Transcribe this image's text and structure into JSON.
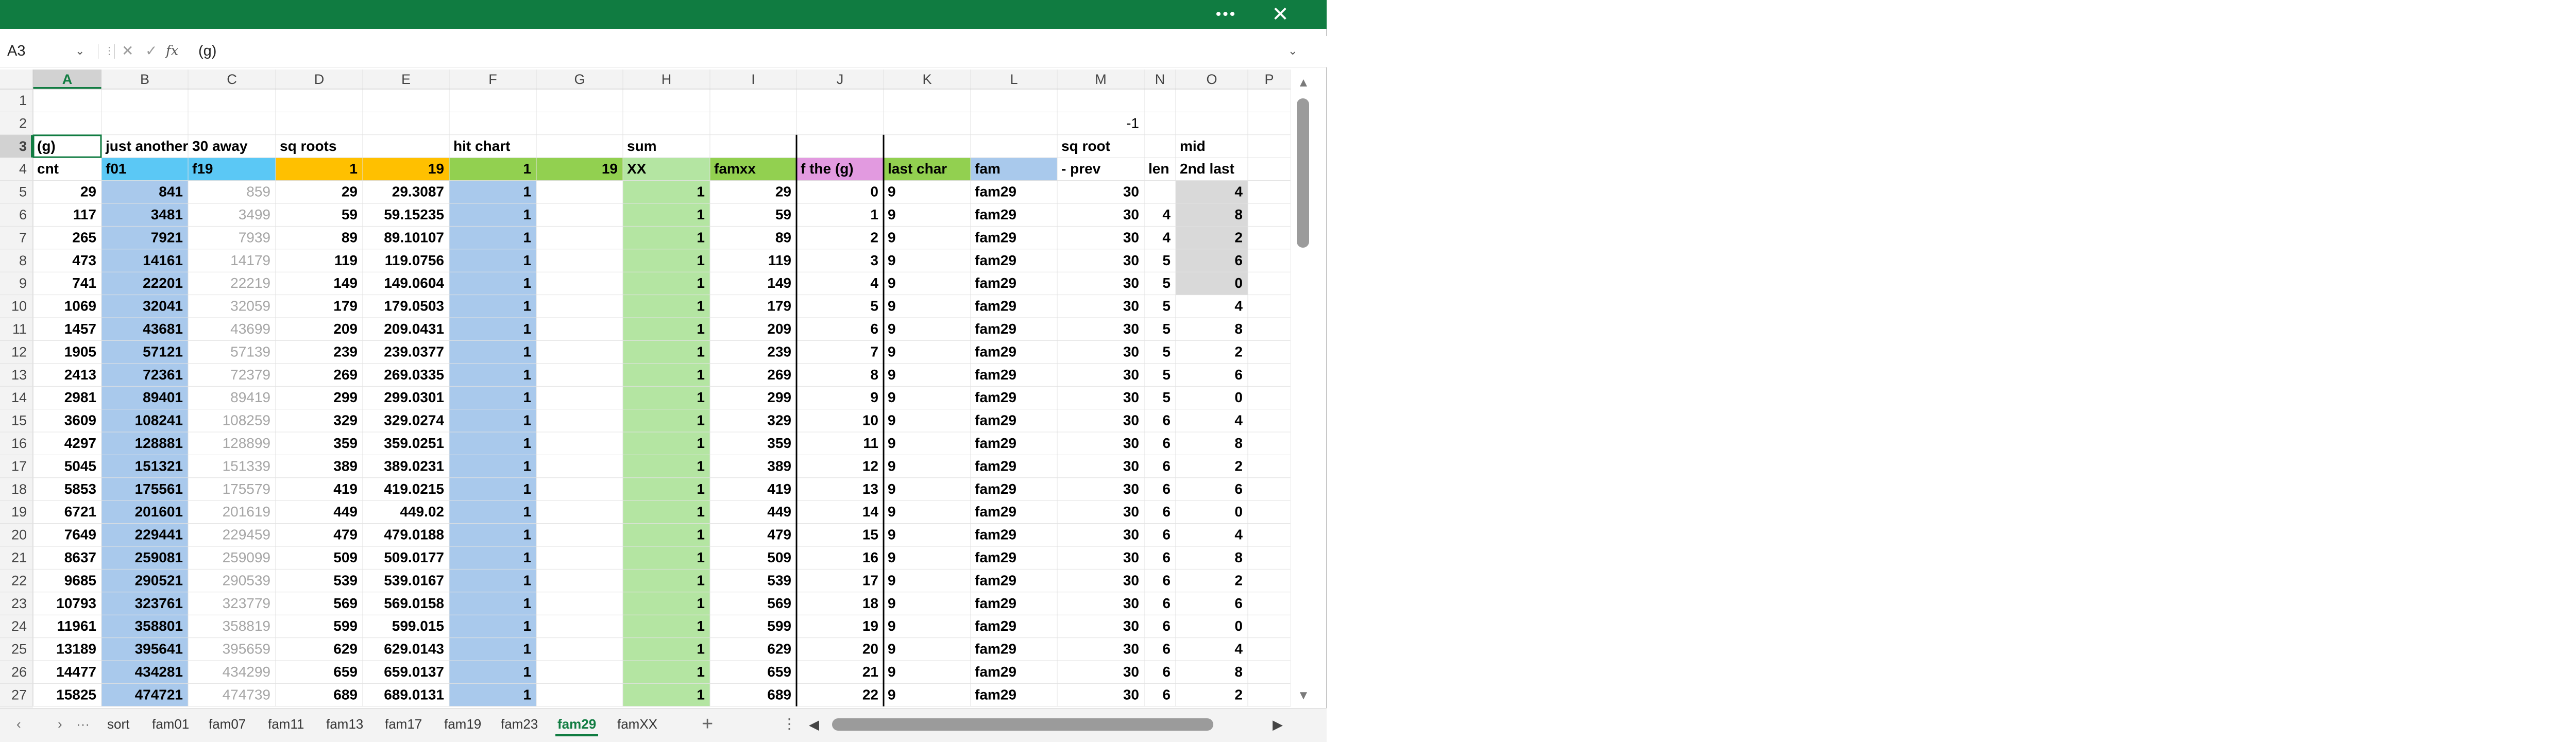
{
  "window": {
    "more_icon": "ellipsis-icon",
    "more_label": "•••",
    "close_icon": "close-icon",
    "close_label": "✕"
  },
  "formula_bar": {
    "name_box": "A3",
    "formula_value": "(g)"
  },
  "columns": [
    "A",
    "B",
    "C",
    "D",
    "E",
    "F",
    "G",
    "H",
    "I",
    "J",
    "K",
    "L",
    "M",
    "N",
    "O",
    "P"
  ],
  "selected_column": "A",
  "row_numbers": [
    1,
    2,
    3,
    4,
    5,
    6,
    7,
    8,
    9,
    10,
    11,
    12,
    13,
    14,
    15,
    16,
    17,
    18,
    19,
    20,
    21,
    22,
    23,
    24,
    25,
    26,
    27
  ],
  "header_rows": {
    "row2": {
      "M": "-1"
    },
    "row3": {
      "A": "(g)",
      "B": "just another 30 away",
      "D": "sq roots",
      "F": "hit chart",
      "H": "sum",
      "M": "sq root",
      "O": "mid"
    },
    "row4": {
      "A": "cnt",
      "B": "f01",
      "C": "f19",
      "D": "1",
      "E": "19",
      "F": "1",
      "G": "19",
      "H": "XX",
      "I": "famxx",
      "J": "f the (g)",
      "K": "last char",
      "L": "fam",
      "M": "- prev",
      "N": "len",
      "O": "2nd last"
    }
  },
  "fill_colors": {
    "cyan": "#5bc8f5",
    "gold": "#ffc000",
    "green": "#92d050",
    "light_green": "#b4e5a2",
    "light_blue": "#a9c9ec",
    "pink": "#e29ae0",
    "grey": "#d9d9d9",
    "gray_text": "#a6a6a6",
    "accent": "#107c41"
  },
  "data_rows": [
    {
      "A": "29",
      "B": "841",
      "C": "859",
      "D": "29",
      "E": "29.3087",
      "F": "1",
      "H": "1",
      "I": "29",
      "J": "0",
      "K": "9",
      "L": "fam29",
      "M": "30",
      "N": "",
      "O": "4"
    },
    {
      "A": "117",
      "B": "3481",
      "C": "3499",
      "D": "59",
      "E": "59.15235",
      "F": "1",
      "H": "1",
      "I": "59",
      "J": "1",
      "K": "9",
      "L": "fam29",
      "M": "30",
      "N": "4",
      "O": "8"
    },
    {
      "A": "265",
      "B": "7921",
      "C": "7939",
      "D": "89",
      "E": "89.10107",
      "F": "1",
      "H": "1",
      "I": "89",
      "J": "2",
      "K": "9",
      "L": "fam29",
      "M": "30",
      "N": "4",
      "O": "2"
    },
    {
      "A": "473",
      "B": "14161",
      "C": "14179",
      "D": "119",
      "E": "119.0756",
      "F": "1",
      "H": "1",
      "I": "119",
      "J": "3",
      "K": "9",
      "L": "fam29",
      "M": "30",
      "N": "5",
      "O": "6"
    },
    {
      "A": "741",
      "B": "22201",
      "C": "22219",
      "D": "149",
      "E": "149.0604",
      "F": "1",
      "H": "1",
      "I": "149",
      "J": "4",
      "K": "9",
      "L": "fam29",
      "M": "30",
      "N": "5",
      "O": "0"
    },
    {
      "A": "1069",
      "B": "32041",
      "C": "32059",
      "D": "179",
      "E": "179.0503",
      "F": "1",
      "H": "1",
      "I": "179",
      "J": "5",
      "K": "9",
      "L": "fam29",
      "M": "30",
      "N": "5",
      "O": "4"
    },
    {
      "A": "1457",
      "B": "43681",
      "C": "43699",
      "D": "209",
      "E": "209.0431",
      "F": "1",
      "H": "1",
      "I": "209",
      "J": "6",
      "K": "9",
      "L": "fam29",
      "M": "30",
      "N": "5",
      "O": "8"
    },
    {
      "A": "1905",
      "B": "57121",
      "C": "57139",
      "D": "239",
      "E": "239.0377",
      "F": "1",
      "H": "1",
      "I": "239",
      "J": "7",
      "K": "9",
      "L": "fam29",
      "M": "30",
      "N": "5",
      "O": "2"
    },
    {
      "A": "2413",
      "B": "72361",
      "C": "72379",
      "D": "269",
      "E": "269.0335",
      "F": "1",
      "H": "1",
      "I": "269",
      "J": "8",
      "K": "9",
      "L": "fam29",
      "M": "30",
      "N": "5",
      "O": "6"
    },
    {
      "A": "2981",
      "B": "89401",
      "C": "89419",
      "D": "299",
      "E": "299.0301",
      "F": "1",
      "H": "1",
      "I": "299",
      "J": "9",
      "K": "9",
      "L": "fam29",
      "M": "30",
      "N": "5",
      "O": "0"
    },
    {
      "A": "3609",
      "B": "108241",
      "C": "108259",
      "D": "329",
      "E": "329.0274",
      "F": "1",
      "H": "1",
      "I": "329",
      "J": "10",
      "K": "9",
      "L": "fam29",
      "M": "30",
      "N": "6",
      "O": "4"
    },
    {
      "A": "4297",
      "B": "128881",
      "C": "128899",
      "D": "359",
      "E": "359.0251",
      "F": "1",
      "H": "1",
      "I": "359",
      "J": "11",
      "K": "9",
      "L": "fam29",
      "M": "30",
      "N": "6",
      "O": "8"
    },
    {
      "A": "5045",
      "B": "151321",
      "C": "151339",
      "D": "389",
      "E": "389.0231",
      "F": "1",
      "H": "1",
      "I": "389",
      "J": "12",
      "K": "9",
      "L": "fam29",
      "M": "30",
      "N": "6",
      "O": "2"
    },
    {
      "A": "5853",
      "B": "175561",
      "C": "175579",
      "D": "419",
      "E": "419.0215",
      "F": "1",
      "H": "1",
      "I": "419",
      "J": "13",
      "K": "9",
      "L": "fam29",
      "M": "30",
      "N": "6",
      "O": "6"
    },
    {
      "A": "6721",
      "B": "201601",
      "C": "201619",
      "D": "449",
      "E": "449.02",
      "F": "1",
      "H": "1",
      "I": "449",
      "J": "14",
      "K": "9",
      "L": "fam29",
      "M": "30",
      "N": "6",
      "O": "0"
    },
    {
      "A": "7649",
      "B": "229441",
      "C": "229459",
      "D": "479",
      "E": "479.0188",
      "F": "1",
      "H": "1",
      "I": "479",
      "J": "15",
      "K": "9",
      "L": "fam29",
      "M": "30",
      "N": "6",
      "O": "4"
    },
    {
      "A": "8637",
      "B": "259081",
      "C": "259099",
      "D": "509",
      "E": "509.0177",
      "F": "1",
      "H": "1",
      "I": "509",
      "J": "16",
      "K": "9",
      "L": "fam29",
      "M": "30",
      "N": "6",
      "O": "8"
    },
    {
      "A": "9685",
      "B": "290521",
      "C": "290539",
      "D": "539",
      "E": "539.0167",
      "F": "1",
      "H": "1",
      "I": "539",
      "J": "17",
      "K": "9",
      "L": "fam29",
      "M": "30",
      "N": "6",
      "O": "2"
    },
    {
      "A": "10793",
      "B": "323761",
      "C": "323779",
      "D": "569",
      "E": "569.0158",
      "F": "1",
      "H": "1",
      "I": "569",
      "J": "18",
      "K": "9",
      "L": "fam29",
      "M": "30",
      "N": "6",
      "O": "6"
    },
    {
      "A": "11961",
      "B": "358801",
      "C": "358819",
      "D": "599",
      "E": "599.015",
      "F": "1",
      "H": "1",
      "I": "599",
      "J": "19",
      "K": "9",
      "L": "fam29",
      "M": "30",
      "N": "6",
      "O": "0"
    },
    {
      "A": "13189",
      "B": "395641",
      "C": "395659",
      "D": "629",
      "E": "629.0143",
      "F": "1",
      "H": "1",
      "I": "629",
      "J": "20",
      "K": "9",
      "L": "fam29",
      "M": "30",
      "N": "6",
      "O": "4"
    },
    {
      "A": "14477",
      "B": "434281",
      "C": "434299",
      "D": "659",
      "E": "659.0137",
      "F": "1",
      "H": "1",
      "I": "659",
      "J": "21",
      "K": "9",
      "L": "fam29",
      "M": "30",
      "N": "6",
      "O": "8"
    },
    {
      "A": "15825",
      "B": "474721",
      "C": "474739",
      "D": "689",
      "E": "689.0131",
      "F": "1",
      "H": "1",
      "I": "689",
      "J": "22",
      "K": "9",
      "L": "fam29",
      "M": "30",
      "N": "6",
      "O": "2"
    }
  ],
  "sheet_tabs": {
    "prev_label": "‹",
    "next_label": "›",
    "more_label": "···",
    "items": [
      "sort",
      "fam01",
      "fam07",
      "fam11",
      "fam13",
      "fam17",
      "fam19",
      "fam23",
      "fam29",
      "famXX"
    ],
    "active": "fam29",
    "add_label": "+",
    "options_label": "⋮"
  },
  "scrollbars": {
    "up_arrow": "▲",
    "down_arrow": "▼",
    "left_arrow": "◀",
    "right_arrow": "▶"
  }
}
